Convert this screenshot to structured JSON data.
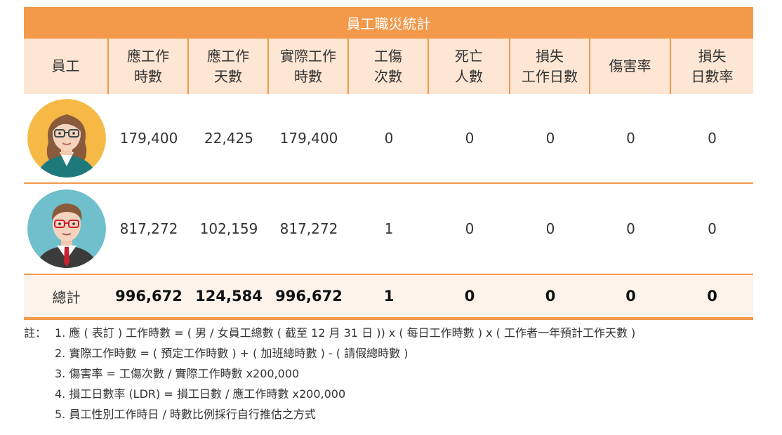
{
  "title": "員工職災統計",
  "headers": [
    "員工",
    "應工作\n時數",
    "應工作\n天數",
    "實際工作\n時數",
    "工傷\n次數",
    "死亡\n人數",
    "損失\n工作日數",
    "傷害率",
    "損失\n日數率"
  ],
  "rows": [
    {
      "avatar": "female-employee-avatar",
      "values": [
        "179,400",
        "22,425",
        "179,400",
        "0",
        "0",
        "0",
        "0",
        "0"
      ]
    },
    {
      "avatar": "male-employee-avatar",
      "values": [
        "817,272",
        "102,159",
        "817,272",
        "1",
        "0",
        "0",
        "0",
        "0"
      ]
    }
  ],
  "total": {
    "label": "總計",
    "values": [
      "996,672",
      "124,584",
      "996,672",
      "1",
      "0",
      "0",
      "0",
      "0"
    ]
  },
  "notes": {
    "prefix": "註：",
    "items": [
      "1. 應 ( 表訂 ) 工作時數 = ( 男 / 女員工總數 ( 截至 12 月 31 日 )) x ( 每日工作時數 ) x ( 工作者一年預計工作天數 )",
      "2. 實際工作時數 = ( 預定工作時數 ) + ( 加班總時數 ) - ( 請假總時數 )",
      "3. 傷害率 = 工傷次數 / 實際工作時數 x200,000",
      "4. 損工日數率 (LDR) = 損工日數 / 應工作時數 x200,000",
      "5. 員工性別工作時日 / 時數比例採行自行推估之方式"
    ]
  },
  "colors": {
    "accent": "#f2994a",
    "header_bg": "#fde6d3",
    "total_bg": "#fdf3ea"
  }
}
